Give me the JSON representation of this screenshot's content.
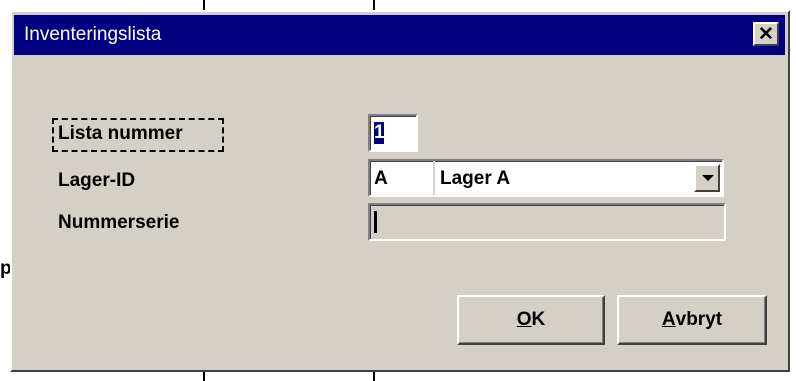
{
  "window": {
    "title": "Inventeringslista",
    "close_symbol": "✕"
  },
  "form": {
    "list_number": {
      "label": "Lista nummer",
      "value": "1"
    },
    "warehouse_id": {
      "label": "Lager-ID",
      "code": "A",
      "name": "Lager A"
    },
    "number_series": {
      "label": "Nummerserie",
      "value": ""
    }
  },
  "buttons": {
    "ok": {
      "mnemonic": "O",
      "rest": "K"
    },
    "cancel": {
      "mnemonic": "A",
      "rest": "vbryt"
    }
  },
  "background": {
    "fragment_text": "p"
  },
  "colors": {
    "titlebar": "#000080",
    "dialog_face": "#d4d0c8",
    "selection": "#000080"
  },
  "icons": [
    "close-icon",
    "dropdown-arrow-icon"
  ]
}
